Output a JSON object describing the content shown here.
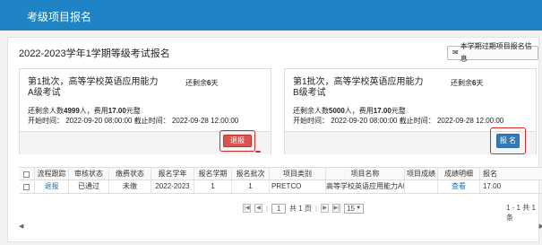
{
  "header": {
    "title": "考级项目报名"
  },
  "page": {
    "title": "2022-2023学年1学期等级考试报名",
    "past_button": "本学期过期项目报名信息"
  },
  "cards": [
    {
      "title": "第1批次，高等学校英语应用能力A级考试",
      "remain_prefix": "还剩余",
      "remain_days": "6",
      "remain_suffix": "天",
      "count_prefix": "还剩余人数",
      "count": "4999",
      "count_mid": "人，费用",
      "fee": "17.00",
      "fee_suffix": "元整",
      "time": "开始时间：  2022-09-20 08:00:00 截止时间：  2022-09-28 12:00:00",
      "action": "退报"
    },
    {
      "title": "第1批次，高等学校英语应用能力B级考试",
      "remain_prefix": "还剩余",
      "remain_days": "6",
      "remain_suffix": "天",
      "count_prefix": "还剩余人数",
      "count": "5000",
      "count_mid": "人，费用",
      "fee": "17.00",
      "fee_suffix": "元整",
      "time": "开始时间：  2022-09-20 08:00:00 截止时间：  2022-09-28 12:00:00",
      "action": "报 名"
    }
  ],
  "table": {
    "headers": [
      "流程跟踪",
      "审核状态",
      "缴费状态",
      "报名学年",
      "报名学期",
      "报名批次",
      "项目类别",
      "项目名称",
      "项目成绩",
      "成绩明细",
      "报名"
    ],
    "row": [
      "退报",
      "已通过",
      "未缴",
      "2022-2023",
      "1",
      "1",
      "PRETCO",
      "高等学校英语应用能力A级",
      "",
      "查看",
      "17.00"
    ]
  },
  "pager": {
    "page": "1",
    "of_text": "共 1 页",
    "page_size": "15",
    "count_text": "1 - 1  共 1 条"
  },
  "colors": {
    "topbar": "#1e84c6",
    "danger": "#d9534f",
    "primary": "#337ab7",
    "highlight": "#d42a2a"
  }
}
